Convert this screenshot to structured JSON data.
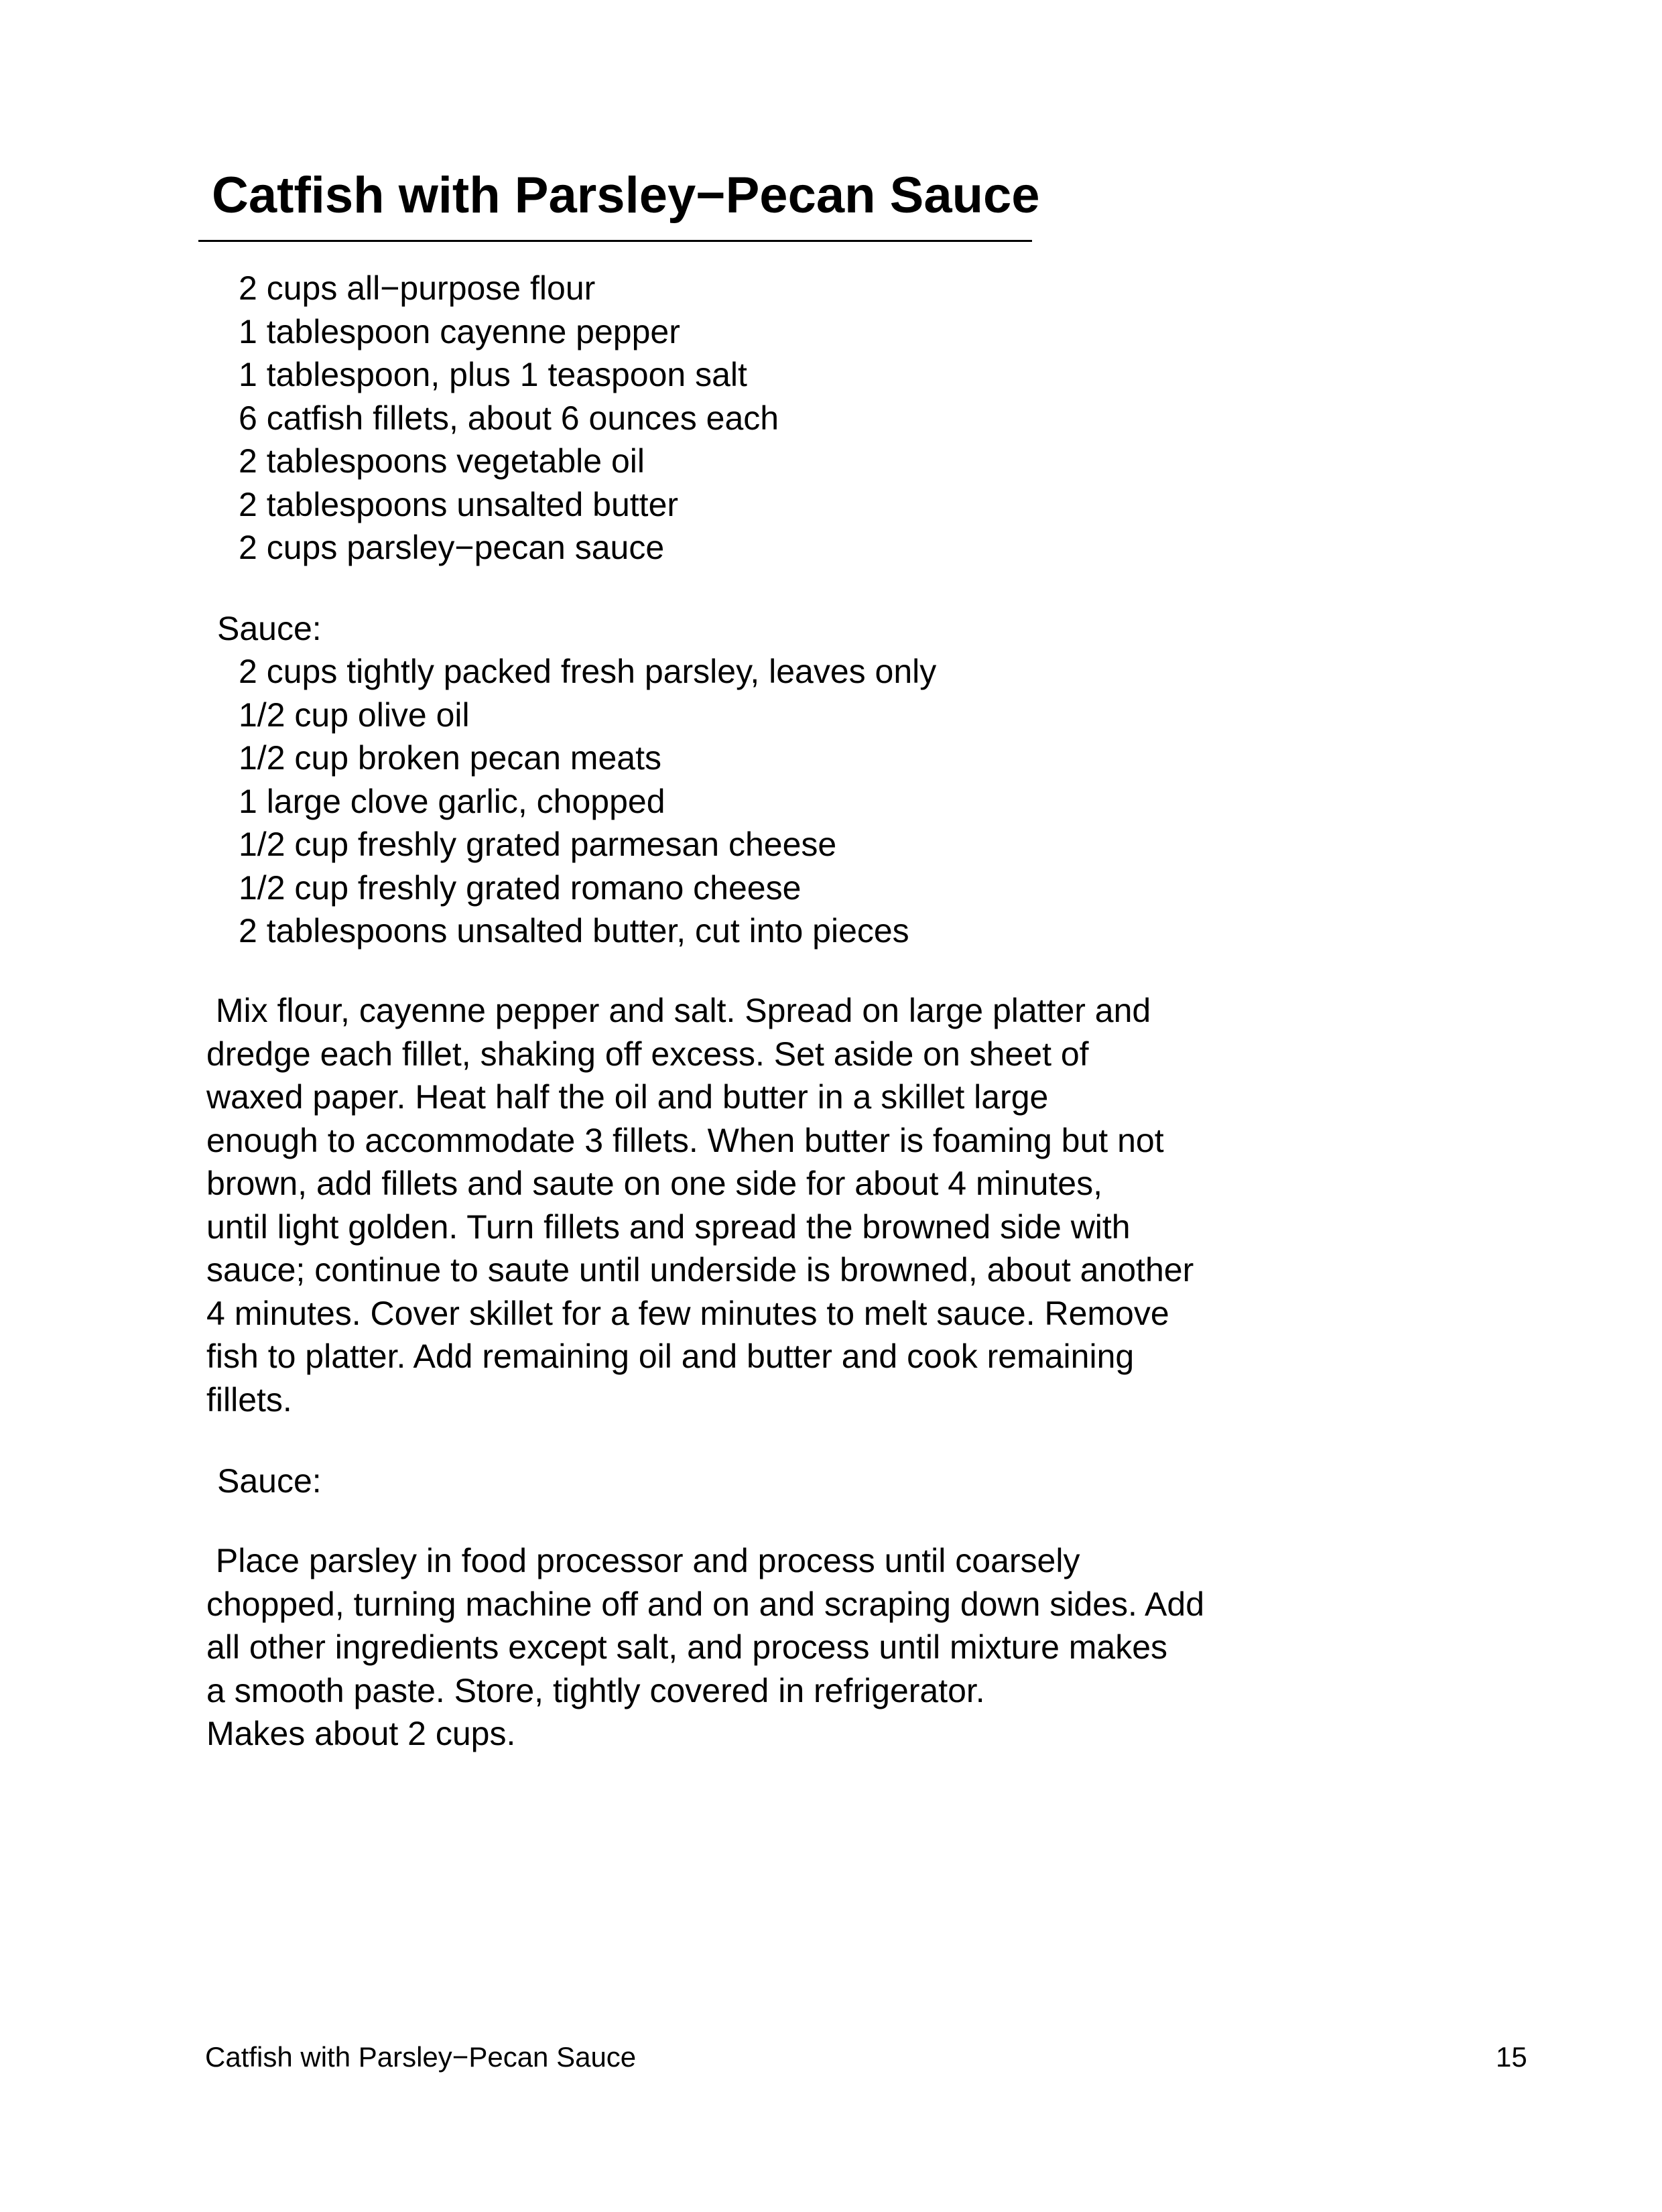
{
  "title": "Catfish with Parsley−Pecan Sauce",
  "ingredients": [
    "2 cups all−purpose flour",
    "1 tablespoon cayenne pepper",
    "1 tablespoon, plus 1 teaspoon salt",
    "6 catfish fillets, about 6 ounces each",
    "2 tablespoons vegetable oil",
    "2 tablespoons unsalted butter",
    "2 cups parsley−pecan sauce"
  ],
  "sauce_label": "Sauce:",
  "sauce_ingredients": [
    "2 cups tightly packed fresh parsley, leaves only",
    "1/2 cup olive oil",
    "1/2 cup broken pecan meats",
    "1 large clove garlic, chopped",
    "1/2 cup freshly grated parmesan cheese",
    "1/2 cup freshly grated romano cheese",
    "2 tablespoons unsalted butter, cut into pieces"
  ],
  "method_lines": [
    " Mix flour, cayenne pepper and salt. Spread on large platter and",
    "dredge each fillet, shaking off excess. Set aside on sheet of",
    "waxed paper. Heat half the oil and butter in a skillet large",
    "enough to accommodate 3 fillets. When butter is foaming but not",
    "brown, add fillets and saute on one side for about 4 minutes,",
    "until light golden. Turn fillets and spread the browned side with",
    "sauce; continue to saute until underside is browned, about another",
    "4 minutes. Cover skillet for a few minutes to melt sauce. Remove",
    "fish to platter. Add remaining oil and butter and cook remaining",
    "fillets."
  ],
  "sauce_label_2": "Sauce:",
  "sauce_method_lines": [
    " Place parsley in food processor and process until coarsely",
    "chopped, turning machine off and on and scraping down sides. Add",
    "all other ingredients except salt, and process until mixture makes",
    "a smooth paste. Store, tightly covered in refrigerator.",
    "Makes about 2 cups."
  ],
  "footer": {
    "title": "Catfish with Parsley−Pecan Sauce",
    "page_number": "15"
  }
}
